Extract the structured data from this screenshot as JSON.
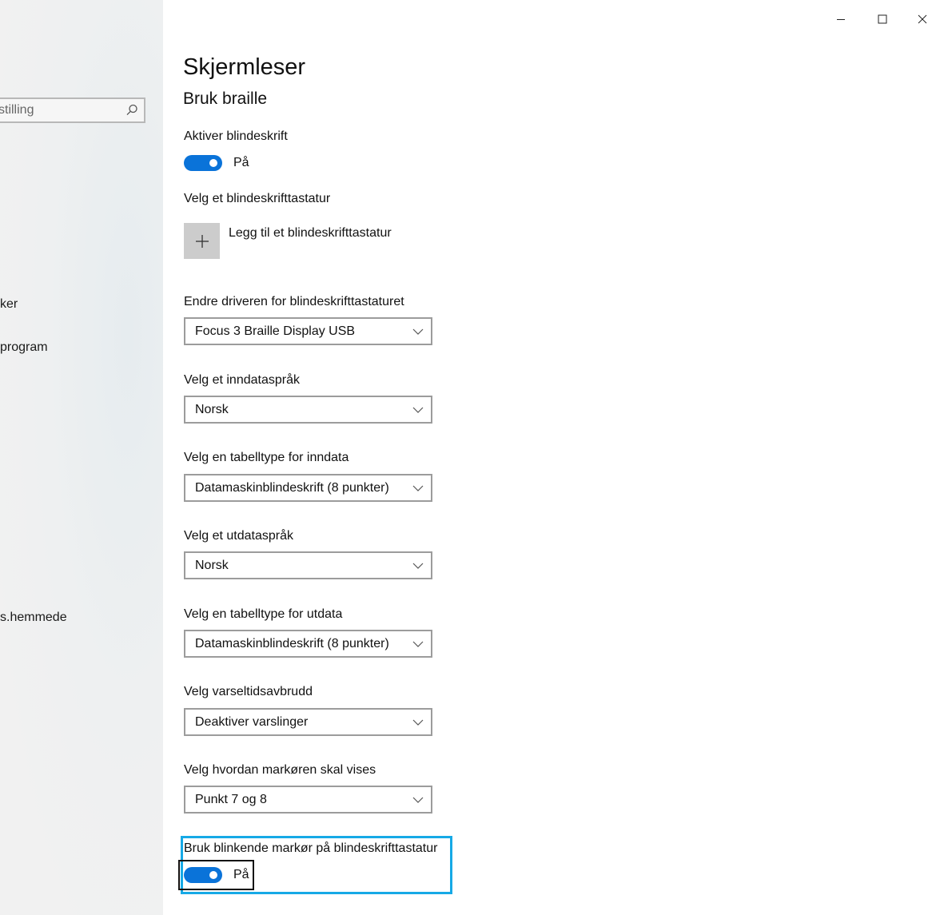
{
  "window": {
    "minimize_icon": "minimize-icon",
    "maximize_icon": "maximize-icon",
    "close_icon": "close-icon"
  },
  "sidebar": {
    "search": {
      "placeholder": "stilling",
      "icon": "search-icon"
    },
    "items": [
      {
        "label": "ker"
      },
      {
        "label": "program"
      },
      {
        "label": "s.hemmede"
      }
    ]
  },
  "page": {
    "title": "Skjermleser",
    "section": "Bruk braille"
  },
  "settings": {
    "enable_braille": {
      "label": "Aktiver blindeskrift",
      "state": "På"
    },
    "choose_keyboard": {
      "label": "Velg et blindeskrifttastatur",
      "add_label": "Legg til et blindeskrifttastatur",
      "add_icon": "plus-icon"
    },
    "driver": {
      "label": "Endre driveren for blindeskrifttastaturet",
      "value": "Focus 3 Braille Display USB"
    },
    "input_language": {
      "label": "Velg et inndataspråk",
      "value": "Norsk"
    },
    "input_table": {
      "label": "Velg en tabelltype for inndata",
      "value": "Datamaskinblindeskrift (8 punkter)"
    },
    "output_language": {
      "label": "Velg et utdataspråk",
      "value": "Norsk"
    },
    "output_table": {
      "label": "Velg en tabelltype for utdata",
      "value": "Datamaskinblindeskrift (8 punkter)"
    },
    "notification_timeout": {
      "label": "Velg varseltidsavbrudd",
      "value": "Deaktiver varslinger"
    },
    "cursor_display": {
      "label": "Velg hvordan markøren skal vises",
      "value": "Punkt 7 og 8"
    },
    "blinking_cursor": {
      "label": "Bruk blinkende markør på blindeskrifttastatur",
      "state": "På"
    }
  },
  "colors": {
    "accent": "#0a73d9",
    "focus": "#16a9e6"
  }
}
